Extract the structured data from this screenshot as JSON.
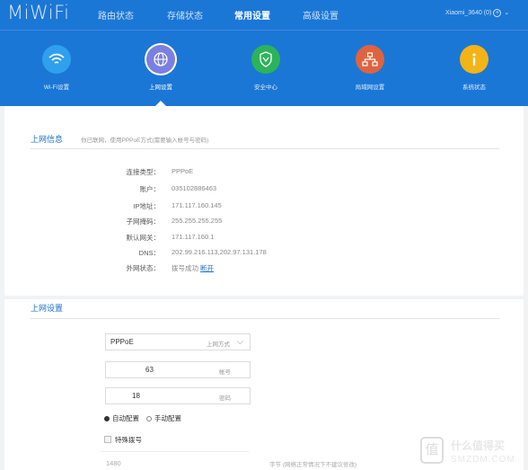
{
  "header": {
    "logo": "MiWiFi",
    "nav": [
      {
        "label": "路由状态"
      },
      {
        "label": "存储状态"
      },
      {
        "label": "常用设置"
      },
      {
        "label": "高级设置"
      }
    ],
    "device": {
      "name": "Xiaomi_3640 (0)",
      "plus": "+"
    }
  },
  "icons": [
    {
      "label": "Wi-Fi设置",
      "icon": "wifi-icon",
      "color": "#2fa0ee"
    },
    {
      "label": "上网设置",
      "icon": "globe-icon",
      "color": "#7b7fe0"
    },
    {
      "label": "安全中心",
      "icon": "shield-icon",
      "color": "#2cb35a"
    },
    {
      "label": "局域网设置",
      "icon": "network-icon",
      "color": "#e0633f"
    },
    {
      "label": "系统状态",
      "icon": "info-icon",
      "color": "#f2b417"
    }
  ],
  "colors": {
    "header_bg": "#1b77d6",
    "accent": "#1b6fc8"
  },
  "info": {
    "title": "上网信息",
    "note": "你已联网，使用PPPoE方式(需要输入帐号与密码)",
    "rows": [
      {
        "label": "连接类型：",
        "value": "PPPoE"
      },
      {
        "label": "账户：",
        "value": "035102886463"
      },
      {
        "label": "IP地址：",
        "value": "171.117.160.145"
      },
      {
        "label": "子网掩码：",
        "value": "255.255.255.255"
      },
      {
        "label": "默认网关：",
        "value": "171.117.160.1"
      },
      {
        "label": "DNS：",
        "value": "202.99.216.113,202.97.131.178"
      },
      {
        "label": "外网状态：",
        "value": "拨号成功",
        "link": "断开"
      }
    ]
  },
  "settings": {
    "title": "上网设置",
    "mode": {
      "value": "PPPoE",
      "hint": "上网方式"
    },
    "account": {
      "value": "63",
      "hint": "帐号"
    },
    "password": {
      "value": "18",
      "hint": "密码"
    },
    "radio_auto": "自动配置",
    "radio_manual": "手动配置",
    "special_dial": "特殊拨号",
    "mtu": {
      "value": "1480",
      "hint": "字节 (网络正常情况下不建议修改)"
    }
  },
  "watermark": {
    "glyph": "值",
    "text1": "什么值得买",
    "text2": "SMZDM.COM"
  }
}
